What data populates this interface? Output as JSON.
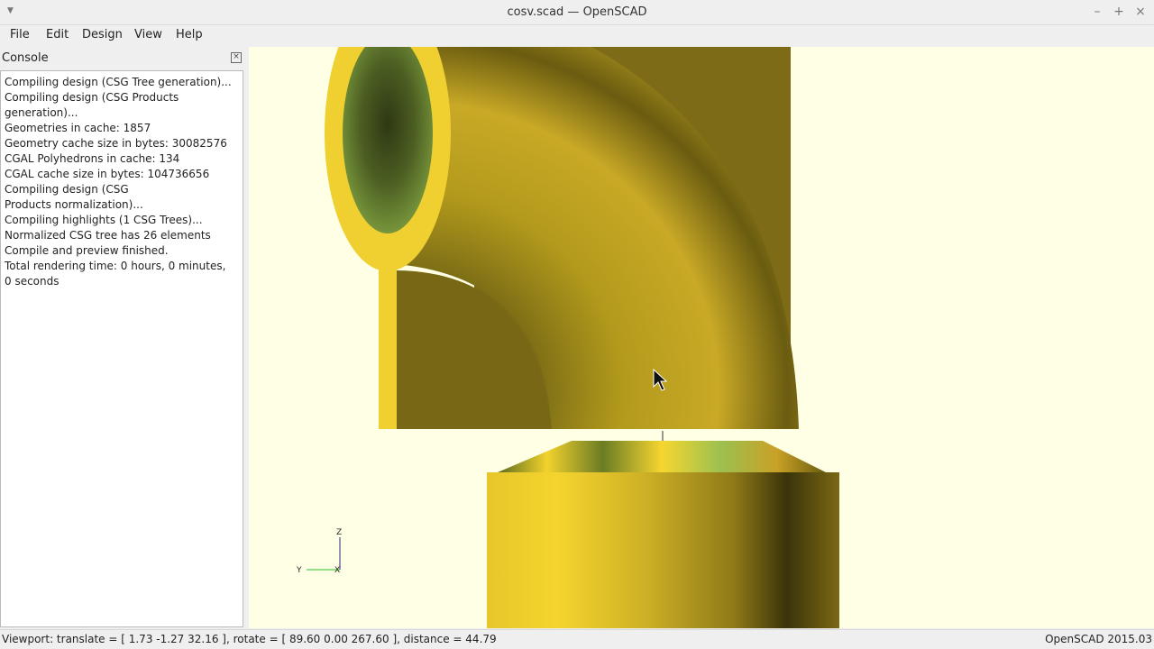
{
  "window": {
    "title": "cosv.scad — OpenSCAD",
    "system_menu_icon": "down-triangle-icon",
    "controls": {
      "minimize": "–",
      "maximize": "+",
      "close": "×"
    }
  },
  "menubar": {
    "items": [
      "File",
      "Edit",
      "Design",
      "View",
      "Help"
    ]
  },
  "console": {
    "title": "Console",
    "lines": [
      "Compiling design (CSG Tree generation)...",
      "Compiling design (CSG Products generation)...",
      "Geometries in cache: 1857",
      "Geometry cache size in bytes: 30082576",
      "CGAL Polyhedrons in cache: 134",
      "CGAL cache size in bytes: 104736656",
      "Compiling design (CSG Products normalization)...",
      "Compiling highlights (1 CSG Trees)...",
      "Normalized CSG tree has 26 elements",
      "Compile and preview finished.",
      "Total rendering time: 0 hours, 0 minutes, 0 seconds"
    ]
  },
  "viewport": {
    "background_color": "#ffffe5",
    "axes": {
      "z_label": "Z",
      "y_label": "Y",
      "x_label": "X"
    }
  },
  "statusbar": {
    "viewport_info": "Viewport: translate = [ 1.73 -1.27 32.16 ], rotate = [ 89.60 0.00 267.60 ], distance = 44.79",
    "version": "OpenSCAD 2015.03"
  }
}
